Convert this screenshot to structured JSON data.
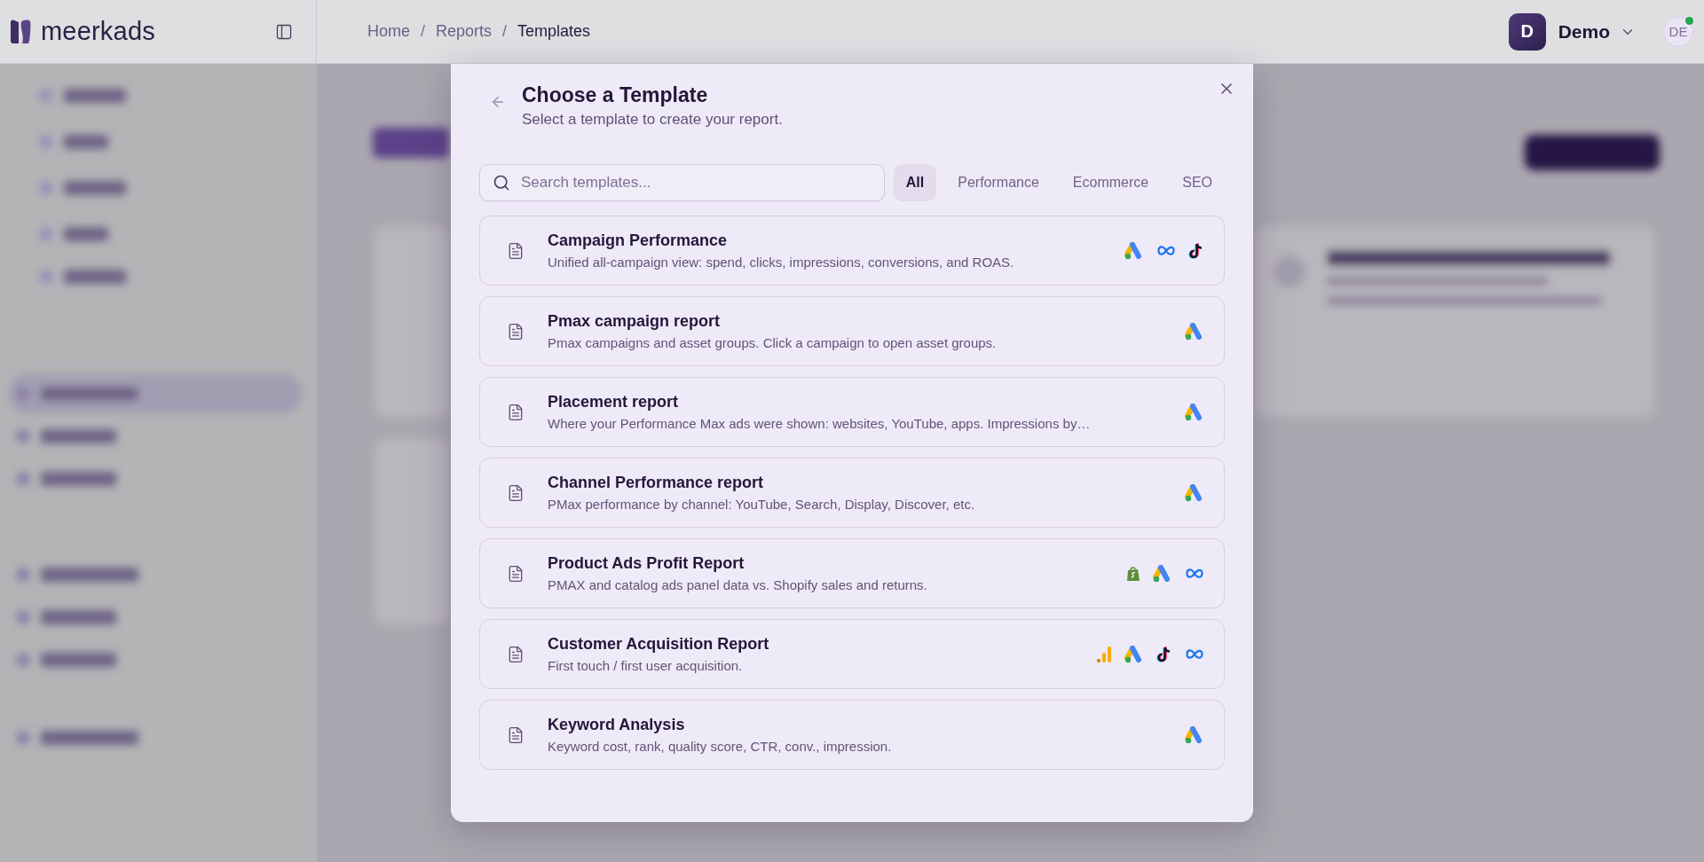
{
  "header": {
    "logo": "meerkads",
    "breadcrumb_separator": "/",
    "breadcrumbs": [
      {
        "label": "Home",
        "current": false
      },
      {
        "label": "Reports",
        "current": false
      },
      {
        "label": "Templates",
        "current": true
      }
    ],
    "workspace": {
      "initial": "D",
      "name": "Demo"
    },
    "user": {
      "initials": "DE",
      "online": true
    }
  },
  "modal": {
    "title": "Choose a Template",
    "subtitle": "Select a template to create your report.",
    "search": {
      "placeholder": "Search templates..."
    },
    "filters": [
      {
        "label": "All",
        "selected": true
      },
      {
        "label": "Performance",
        "selected": false
      },
      {
        "label": "Ecommerce",
        "selected": false
      },
      {
        "label": "SEO",
        "selected": false
      }
    ],
    "templates": [
      {
        "title": "Campaign Performance",
        "description": "Unified all-campaign view: spend, clicks, impressions, conversions, and ROAS.",
        "sources": [
          {
            "kind": "google_ads"
          },
          {
            "kind": "meta"
          },
          {
            "kind": "tiktok"
          }
        ]
      },
      {
        "title": "Pmax campaign report",
        "description": "Pmax campaigns and asset groups. Click a campaign to open asset groups.",
        "sources": [
          {
            "kind": "google_ads"
          }
        ]
      },
      {
        "title": "Placement report",
        "description": "Where your Performance Max ads were shown: websites, YouTube, apps. Impressions by…",
        "sources": [
          {
            "kind": "google_ads"
          }
        ]
      },
      {
        "title": "Channel Performance report",
        "description": "PMax performance by channel: YouTube, Search, Display, Discover, etc.",
        "sources": [
          {
            "kind": "google_ads"
          }
        ]
      },
      {
        "title": "Product Ads Profit Report",
        "description": "PMAX and catalog ads panel data vs. Shopify sales and returns.",
        "sources": [
          {
            "kind": "shopify"
          },
          {
            "kind": "google_ads"
          },
          {
            "kind": "meta"
          }
        ]
      },
      {
        "title": "Customer Acquisition Report",
        "description": "First touch / first user acquisition.",
        "sources": [
          {
            "kind": "analytics"
          },
          {
            "kind": "google_ads"
          },
          {
            "kind": "tiktok"
          },
          {
            "kind": "meta"
          }
        ]
      },
      {
        "title": "Keyword Analysis",
        "description": "Keyword cost, rank, quality score, CTR, conv., impression.",
        "sources": [
          {
            "kind": "google_ads"
          }
        ]
      }
    ]
  }
}
